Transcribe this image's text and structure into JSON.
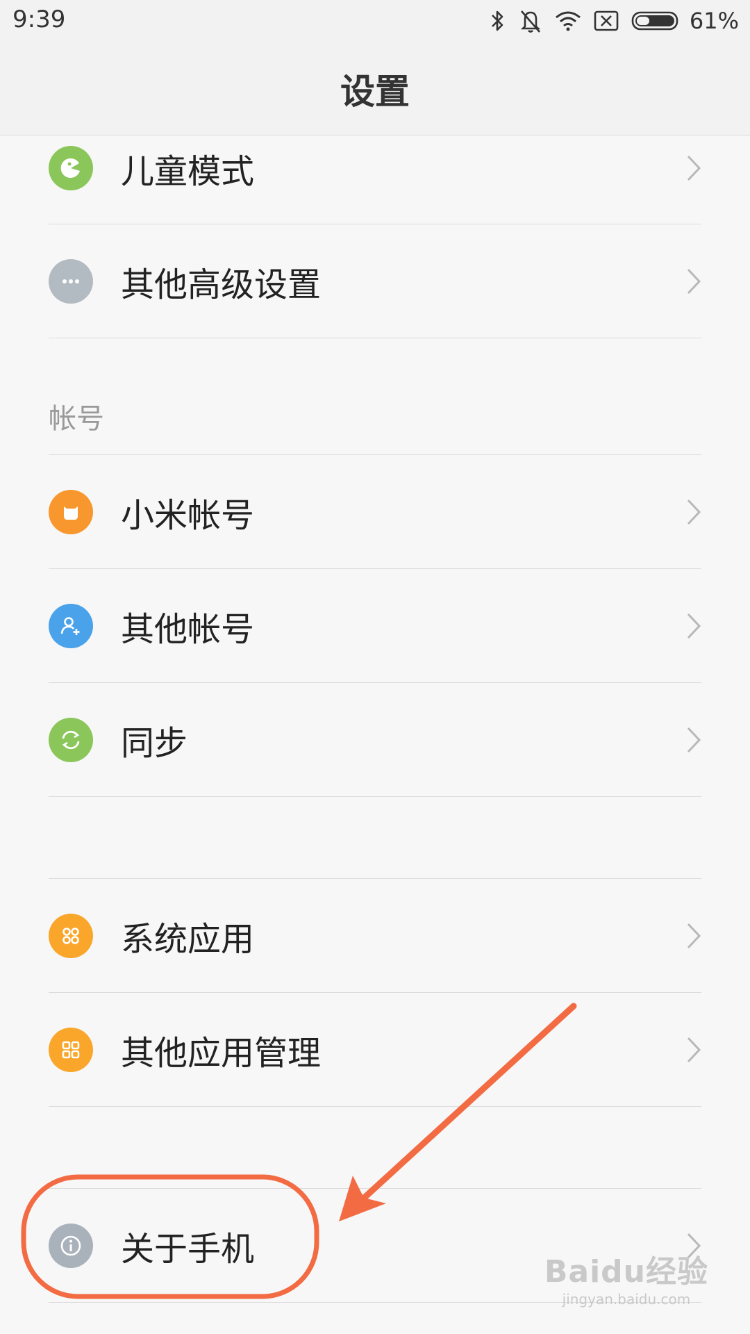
{
  "status_bar": {
    "time": "9:39",
    "battery": "61%",
    "icons": [
      "bluetooth-icon",
      "bell-off-icon",
      "wifi-icon",
      "sim-x-icon",
      "battery-icon"
    ]
  },
  "header": {
    "title": "设置"
  },
  "items": [
    {
      "label": "儿童模式",
      "icon": "kid-mode-icon",
      "icon_color": "#8bc65a"
    },
    {
      "label": "其他高级设置",
      "icon": "more-dots-icon",
      "icon_color": "#b2bac2"
    },
    {
      "label": "小米帐号",
      "icon": "mi-account-icon",
      "icon_color": "#f7972d"
    },
    {
      "label": "其他帐号",
      "icon": "add-account-icon",
      "icon_color": "#4aa3ea"
    },
    {
      "label": "同步",
      "icon": "sync-icon",
      "icon_color": "#8bc65a"
    },
    {
      "label": "系统应用",
      "icon": "apps-icon",
      "icon_color": "#f9a62b"
    },
    {
      "label": "其他应用管理",
      "icon": "apps-manage-icon",
      "icon_color": "#f9a62b"
    },
    {
      "label": "关于手机",
      "icon": "info-icon",
      "icon_color": "#a9b1ba"
    }
  ],
  "sections": {
    "account": "帐号"
  },
  "annotation": {
    "color": "#f26b43",
    "highlight": "关于手机"
  },
  "watermark": {
    "main": "Baidu经验",
    "sub": "jingyan.baidu.com"
  }
}
